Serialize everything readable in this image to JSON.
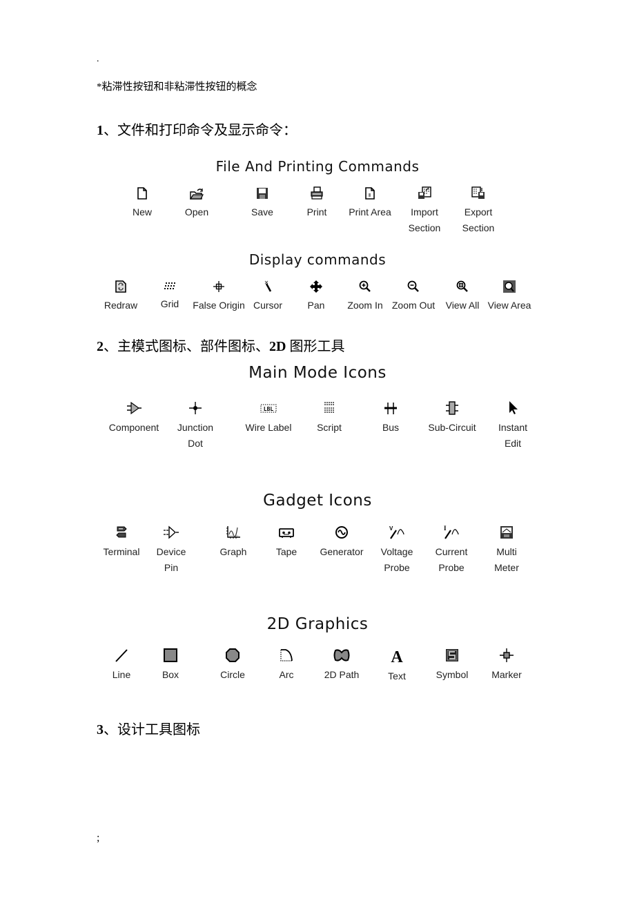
{
  "page": {
    "top_mark": ".",
    "note": "*粘滞性按钮和非粘滞性按钮的概念",
    "heading1": {
      "num": "1",
      "text": "、文件和打印命令及显示命令："
    },
    "heading2": {
      "num": "2",
      "text": "、主模式图标、部件图标、",
      "bold": "2D",
      "text2": " 图形工具"
    },
    "heading3": {
      "num": "3",
      "text": "、设计工具图标"
    },
    "bottom_mark": ";"
  },
  "sections": {
    "file": {
      "title": "File And Printing Commands",
      "items": [
        {
          "icon": "new-document-icon",
          "label": "New"
        },
        {
          "icon": "open-folder-icon",
          "label": "Open"
        },
        {
          "icon": "floppy-disk-icon",
          "label": "Save"
        },
        {
          "icon": "printer-icon",
          "label": "Print"
        },
        {
          "icon": "print-area-icon",
          "label": "Print Area"
        },
        {
          "icon": "import-section-icon",
          "label": "Import",
          "label2": "Section"
        },
        {
          "icon": "export-section-icon",
          "label": "Export",
          "label2": "Section"
        }
      ]
    },
    "display": {
      "title": "Display commands",
      "items": [
        {
          "icon": "redraw-icon",
          "label": "Redraw"
        },
        {
          "icon": "grid-icon",
          "label": "Grid"
        },
        {
          "icon": "crosshair-origin-icon",
          "label": "False Origin"
        },
        {
          "icon": "cursor-icon",
          "label": "Cursor"
        },
        {
          "icon": "pan-arrows-icon",
          "label": "Pan"
        },
        {
          "icon": "zoom-in-icon",
          "label": "Zoom In"
        },
        {
          "icon": "zoom-out-icon",
          "label": "Zoom Out"
        },
        {
          "icon": "view-all-icon",
          "label": "View All"
        },
        {
          "icon": "view-area-icon",
          "label": "View Area"
        }
      ]
    },
    "main_mode": {
      "title": "Main Mode Icons",
      "items": [
        {
          "icon": "component-icon",
          "label": "Component"
        },
        {
          "icon": "junction-dot-icon",
          "label": "Junction",
          "label2": "Dot"
        },
        {
          "icon": "wire-label-icon",
          "label": "Wire Label"
        },
        {
          "icon": "script-icon",
          "label": "Script"
        },
        {
          "icon": "bus-icon",
          "label": "Bus"
        },
        {
          "icon": "sub-circuit-icon",
          "label": "Sub-Circuit"
        },
        {
          "icon": "pointer-arrow-icon",
          "label": "Instant",
          "label2": "Edit"
        }
      ]
    },
    "gadget": {
      "title": "Gadget Icons",
      "items": [
        {
          "icon": "terminal-icon",
          "label": "Terminal"
        },
        {
          "icon": "device-pin-icon",
          "label": "Device",
          "label2": "Pin"
        },
        {
          "icon": "graph-icon",
          "label": "Graph"
        },
        {
          "icon": "tape-icon",
          "label": "Tape"
        },
        {
          "icon": "generator-icon",
          "label": "Generator"
        },
        {
          "icon": "voltage-probe-icon",
          "label": "Voltage",
          "label2": "Probe"
        },
        {
          "icon": "current-probe-icon",
          "label": "Current",
          "label2": "Probe"
        },
        {
          "icon": "multimeter-icon",
          "label": "Multi",
          "label2": "Meter"
        }
      ]
    },
    "graphics2d": {
      "title": "2D Graphics",
      "items": [
        {
          "icon": "line-icon",
          "label": "Line"
        },
        {
          "icon": "box-icon",
          "label": "Box"
        },
        {
          "icon": "circle-icon",
          "label": "Circle"
        },
        {
          "icon": "arc-icon",
          "label": "Arc"
        },
        {
          "icon": "path-icon",
          "label": "2D Path"
        },
        {
          "icon": "text-icon",
          "label": "Text"
        },
        {
          "icon": "symbol-icon",
          "label": "Symbol"
        },
        {
          "icon": "marker-icon",
          "label": "Marker"
        }
      ]
    }
  }
}
